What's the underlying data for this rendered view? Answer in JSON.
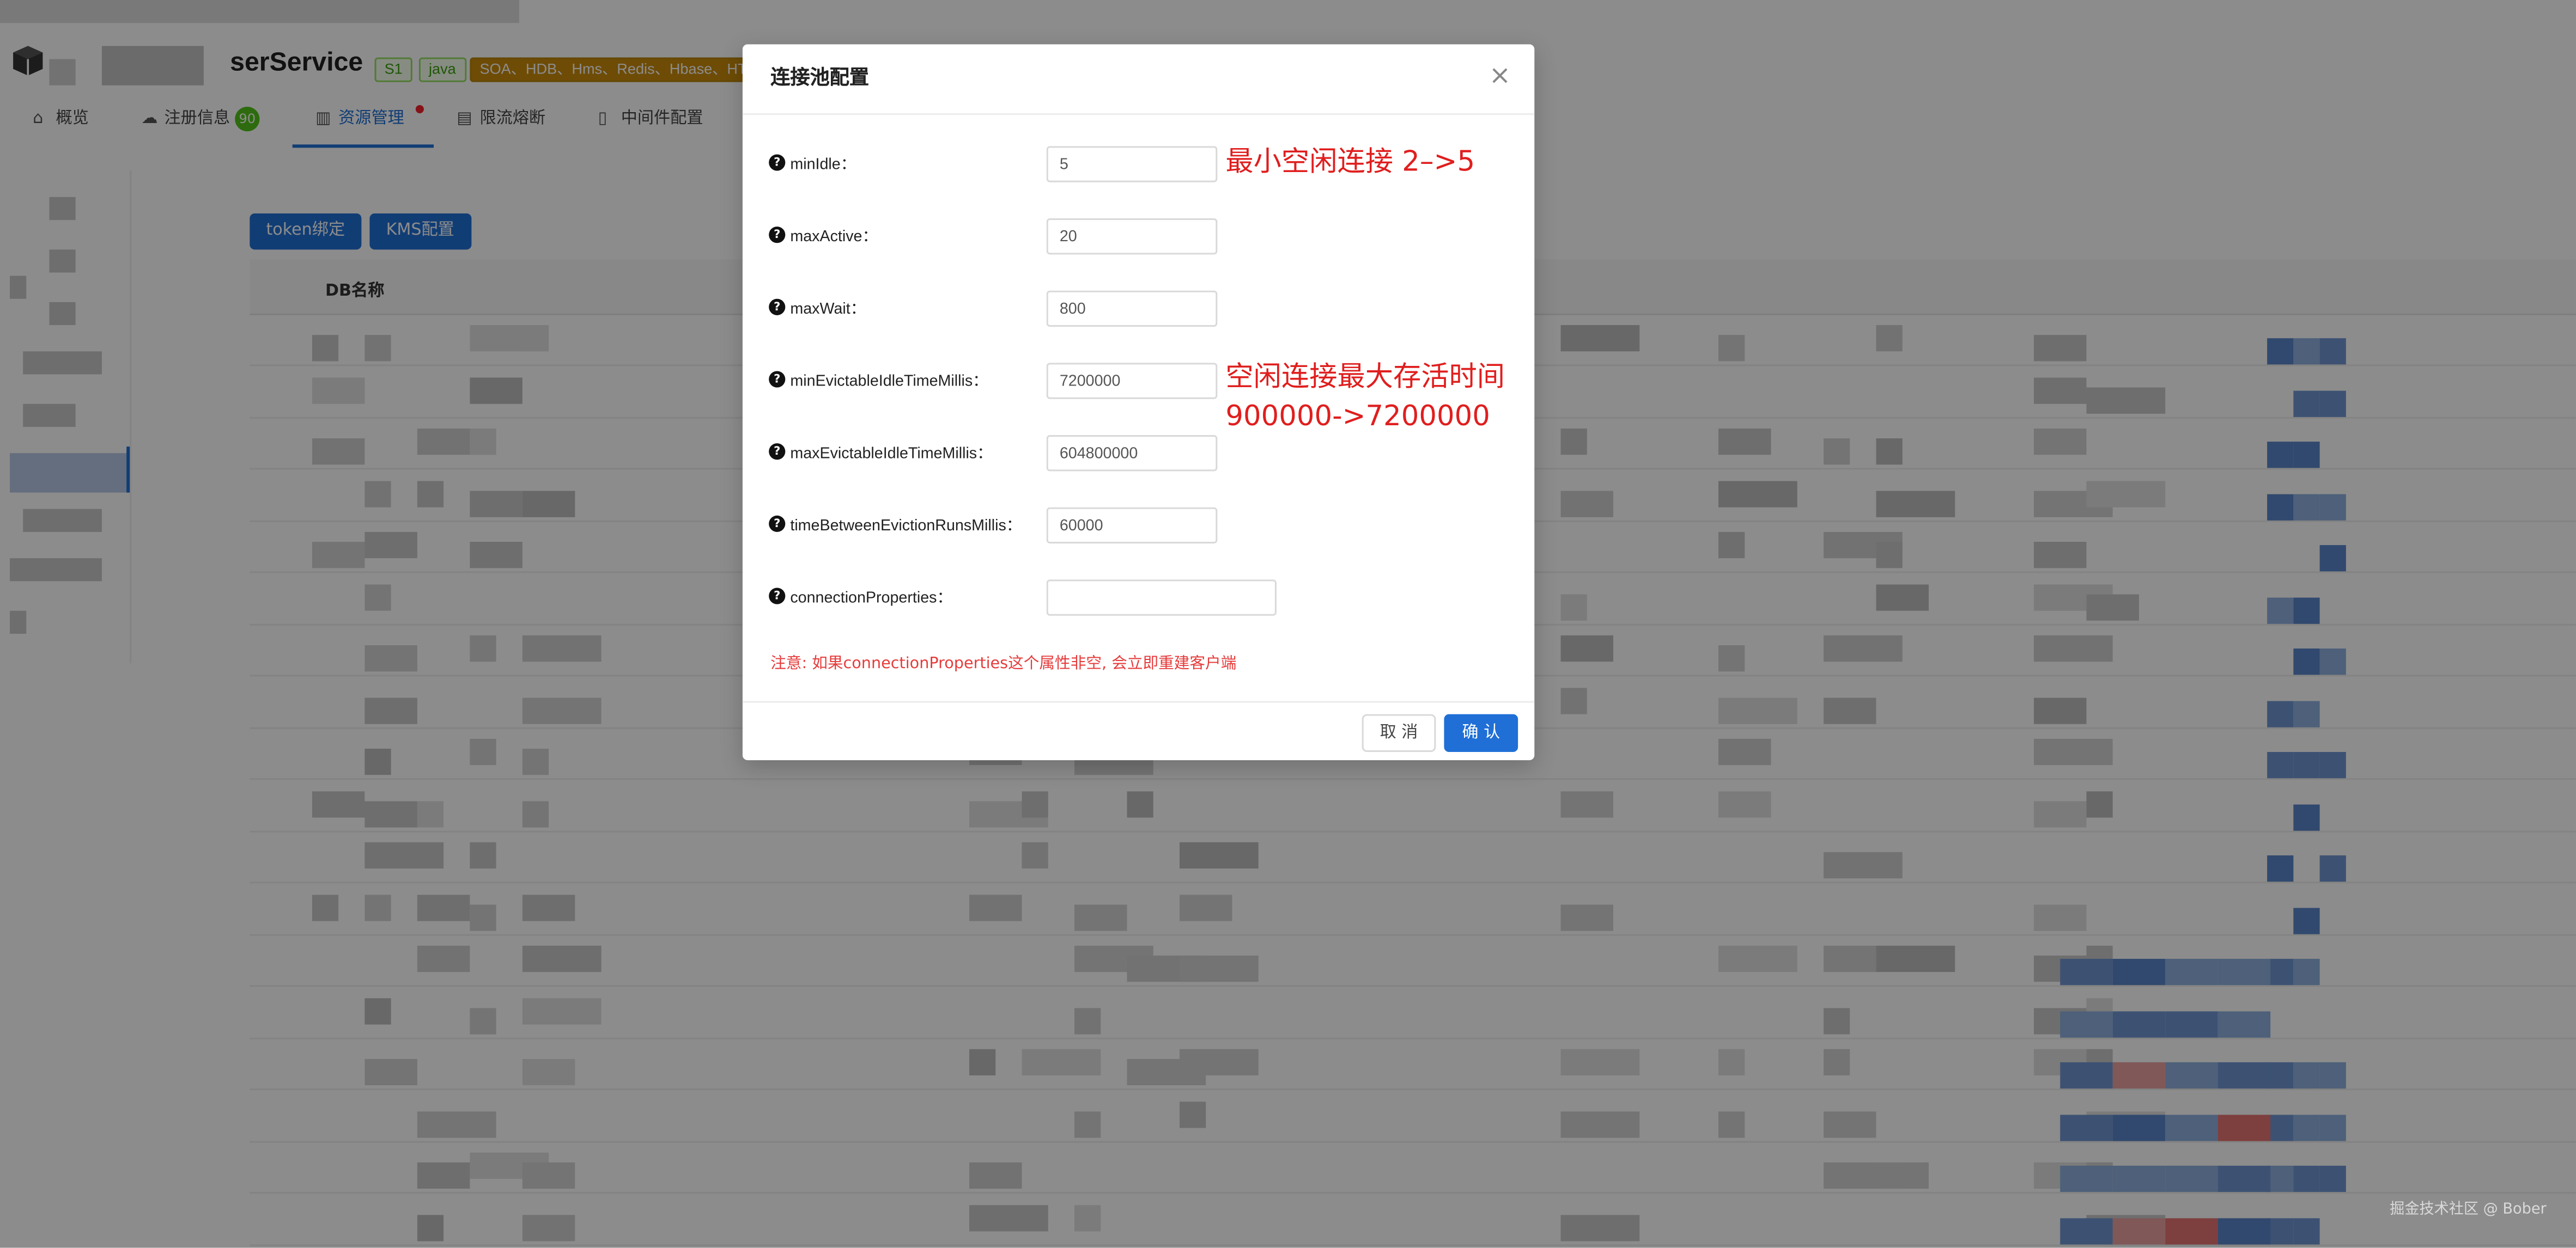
{
  "header": {
    "service_name": "serService",
    "tags": [
      "S1",
      "java",
      "SOA、HDB、Hms、Redis、Hbase、HTTP"
    ]
  },
  "tabs": [
    {
      "label": "概览",
      "icon": "home-icon"
    },
    {
      "label": "注册信息",
      "icon": "cloud-icon",
      "badge": "90"
    },
    {
      "label": "资源管理",
      "icon": "bar-chart-icon",
      "active": true,
      "dot": true
    },
    {
      "label": "限流熔断",
      "icon": "line-chart-icon"
    },
    {
      "label": "中间件配置",
      "icon": "file-icon"
    }
  ],
  "toolbar": {
    "token_label": "token绑定",
    "kms_label": "KMS配置"
  },
  "table": {
    "col_db": "DB名称"
  },
  "modal": {
    "title": "连接池配置",
    "close": "×",
    "fields": [
      {
        "label": "minIdle：",
        "value": "5"
      },
      {
        "label": "maxActive：",
        "value": "20"
      },
      {
        "label": "maxWait：",
        "value": "800"
      },
      {
        "label": "minEvictableIdleTimeMillis：",
        "value": "7200000"
      },
      {
        "label": "maxEvictableIdleTimeMillis：",
        "value": "604800000"
      },
      {
        "label": "timeBetweenEvictionRunsMillis：",
        "value": "60000"
      },
      {
        "label": "connectionProperties：",
        "value": ""
      }
    ],
    "note": "注意: 如果connectionProperties这个属性非空, 会立即重建客户端",
    "cancel_label": "取 消",
    "ok_label": "确 认"
  },
  "annotations": {
    "min_idle": "最小空闲连接 2–>5",
    "evictable_line1": "空闲连接最大存活时间",
    "evictable_line2": "900000->7200000"
  },
  "watermark": "掘金技术社区 @ Bober",
  "colors": {
    "primary": "#1f6fd6",
    "annotation": "#e01e1e",
    "note": "#e63b3b"
  }
}
